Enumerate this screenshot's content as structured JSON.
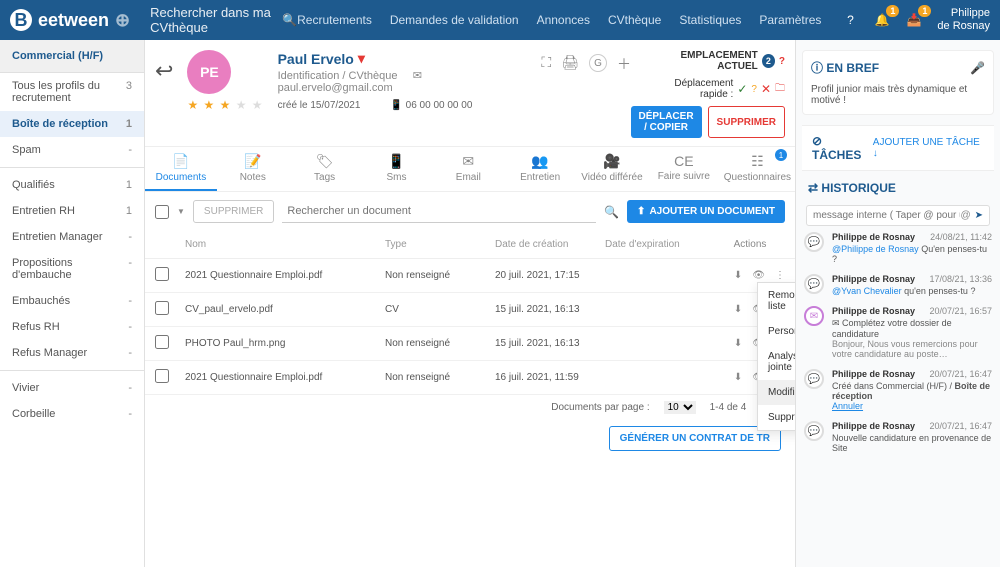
{
  "header": {
    "logo": "eetween",
    "search_placeholder": "Rechercher dans ma CVthèque",
    "nav": [
      "Recrutements",
      "Demandes de validation",
      "Annonces",
      "CVthèque",
      "Statistiques",
      "Paramètres"
    ],
    "notif1": "1",
    "notif2": "1",
    "user_name": "Philippe",
    "user_last": "de Rosnay"
  },
  "sidebar": {
    "title": "Commercial (H/F)",
    "groups": [
      [
        {
          "label": "Tous les profils du recrutement",
          "count": "3"
        },
        {
          "label": "Boîte de réception",
          "count": "1",
          "selected": true
        },
        {
          "label": "Spam",
          "count": "-"
        }
      ],
      [
        {
          "label": "Qualifiés",
          "count": "1"
        },
        {
          "label": "Entretien RH",
          "count": "1"
        },
        {
          "label": "Entretien Manager",
          "count": "-"
        },
        {
          "label": "Propositions d'embauche",
          "count": "-"
        },
        {
          "label": "Embauchés",
          "count": "-"
        },
        {
          "label": "Refus RH",
          "count": "-"
        },
        {
          "label": "Refus Manager",
          "count": "-"
        }
      ],
      [
        {
          "label": "Vivier",
          "count": "-"
        },
        {
          "label": "Corbeille",
          "count": "-"
        }
      ]
    ]
  },
  "profile": {
    "initials": "PE",
    "name": "Paul Ervelo",
    "sub": "Identification / CVthèque",
    "email": "paul.ervelo@gmail.com",
    "created": "créé le 15/07/2021",
    "phone": "06 00 00 00 00",
    "stars_filled": 3,
    "location_label": "EMPLACEMENT ACTUEL",
    "location_count": "2",
    "quick_move": "Déplacement rapide :",
    "btn_move": "DÉPLACER / COPIER",
    "btn_delete": "SUPPRIMER"
  },
  "tabs": [
    {
      "icon": "📄",
      "label": "Documents",
      "active": true
    },
    {
      "icon": "📝",
      "label": "Notes"
    },
    {
      "icon": "🏷",
      "label": "Tags"
    },
    {
      "icon": "📱",
      "label": "Sms"
    },
    {
      "icon": "✉",
      "label": "Email"
    },
    {
      "icon": "👥",
      "label": "Entretien"
    },
    {
      "icon": "🎥",
      "label": "Vidéo différée"
    },
    {
      "icon": "CE",
      "label": "Faire suivre"
    },
    {
      "icon": "☷",
      "label": "Questionnaires",
      "badge": "1"
    }
  ],
  "doc_toolbar": {
    "delete": "SUPPRIMER",
    "search_placeholder": "Rechercher un document",
    "add": "AJOUTER UN DOCUMENT"
  },
  "doc_table": {
    "headers": {
      "name": "Nom",
      "type": "Type",
      "created": "Date de création",
      "exp": "Date d'expiration",
      "actions": "Actions"
    },
    "rows": [
      {
        "name": "2021 Questionnaire Emploi.pdf",
        "type": "Non renseigné",
        "created": "20 juil. 2021, 17:15"
      },
      {
        "name": "CV_paul_ervelo.pdf",
        "type": "CV",
        "created": "15 juil. 2021, 16:13"
      },
      {
        "name": "PHOTO Paul_hrm.png",
        "type": "Non renseigné",
        "created": "15 juil. 2021, 16:13"
      },
      {
        "name": "2021 Questionnaire Emploi.pdf",
        "type": "Non renseigné",
        "created": "16 juil. 2021, 11:59"
      }
    ],
    "footer": {
      "label": "Documents par page :",
      "per": "10",
      "range": "1-4 de 4"
    },
    "generate": "GÉNÉRER UN CONTRAT DE TR"
  },
  "ctx": [
    "Remonter en tête de liste",
    "Personnaliser",
    "Analyser la pièce jointe",
    "Modifier",
    "Supprimer"
  ],
  "brief": {
    "title": "EN BREF",
    "body": "Profil junior mais très dynamique et motivé !"
  },
  "taches": {
    "title": "TÂCHES",
    "add": "AJOUTER UNE TÂCHE"
  },
  "history": {
    "title": "HISTORIQUE",
    "msg_placeholder": "message interne ( Taper @ pour utilisateur ) ...",
    "items": [
      {
        "author": "Philippe de Rosnay",
        "date": "24/08/21, 11:42",
        "mention": "@Philippe de Rosnay",
        "text": "Qu'en penses-tu ?"
      },
      {
        "author": "Philippe de Rosnay",
        "date": "17/08/21, 13:36",
        "mention": "@Yvan Chevalier",
        "text": "qu'en penses-tu ?"
      },
      {
        "author": "Philippe de Rosnay",
        "date": "20/07/21, 16:57",
        "email": true,
        "subject": "Complétez votre dossier de candidature",
        "body": "Bonjour, Nous vous remercions pour votre candidature au poste…"
      },
      {
        "author": "Philippe de Rosnay",
        "date": "20/07/21, 16:47",
        "text_pre": "Créé dans Commercial (H/F) /",
        "text_bold": "Boîte de réception",
        "link": "Annuler"
      },
      {
        "author": "Philippe de Rosnay",
        "date": "20/07/21, 16:47",
        "text": "Nouvelle candidature en provenance de Site"
      }
    ]
  }
}
